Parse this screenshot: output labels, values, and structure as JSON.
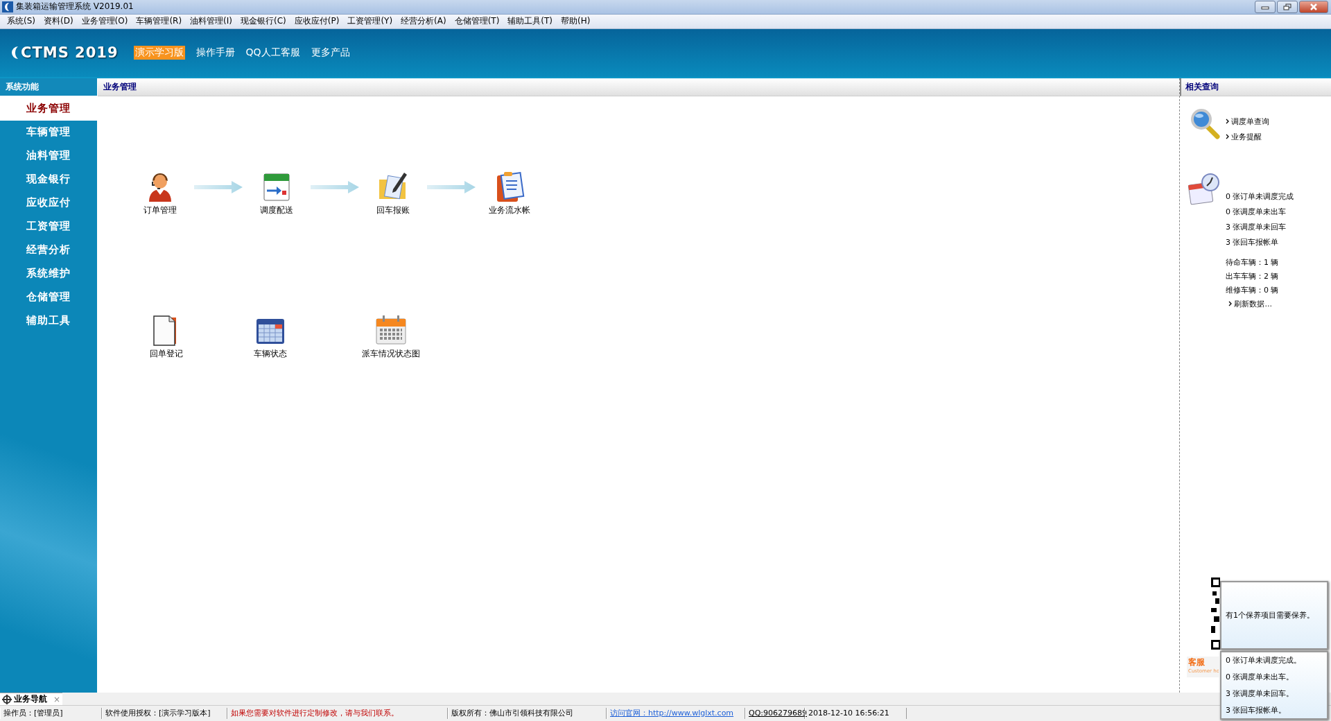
{
  "window": {
    "title": "集装箱运输管理系统 V2019.01"
  },
  "menu": [
    "系统(S)",
    "资料(D)",
    "业务管理(O)",
    "车辆管理(R)",
    "油料管理(I)",
    "现金银行(C)",
    "应收应付(P)",
    "工资管理(Y)",
    "经营分析(A)",
    "仓储管理(T)",
    "辅助工具(T)",
    "帮助(H)"
  ],
  "header": {
    "logo": "CTMS 2019",
    "badge": "演示学习版",
    "links": [
      "操作手册",
      "QQ人工客服",
      "更多产品"
    ]
  },
  "sidebar": {
    "title": "系统功能",
    "items": [
      {
        "label": "业务管理",
        "selected": true
      },
      {
        "label": "车辆管理",
        "selected": false
      },
      {
        "label": "油料管理",
        "selected": false
      },
      {
        "label": "现金银行",
        "selected": false
      },
      {
        "label": "应收应付",
        "selected": false
      },
      {
        "label": "工资管理",
        "selected": false
      },
      {
        "label": "经营分析",
        "selected": false
      },
      {
        "label": "系统维护",
        "selected": false
      },
      {
        "label": "仓储管理",
        "selected": false
      },
      {
        "label": "辅助工具",
        "selected": false
      }
    ]
  },
  "main": {
    "title": "业务管理",
    "flow": [
      {
        "label": "订单管理",
        "kind": "operator"
      },
      {
        "label": "调度配送",
        "kind": "schedule"
      },
      {
        "label": "回车报账",
        "kind": "folder"
      },
      {
        "label": "业务流水帐",
        "kind": "clipboard"
      }
    ],
    "tools": [
      {
        "label": "回单登记",
        "kind": "document"
      },
      {
        "label": "车辆状态",
        "kind": "calendar"
      },
      {
        "label": "派车情况状态图",
        "kind": "planner"
      }
    ]
  },
  "related": {
    "title": "相关查询",
    "links": [
      "调度单查询",
      "业务提醒"
    ],
    "counts": [
      "0 张订单未调度完成",
      "0 张调度单未出车",
      "3 张调度单未回车",
      "3 张回车报帐单"
    ],
    "vehicles": [
      "待命车辆：1 辆",
      "出车车辆：2 辆",
      "维修车辆：0 辆"
    ],
    "refresh": "刷新数据...",
    "service": {
      "label": "客服",
      "sublabel": "Customer ho"
    }
  },
  "bottom_tab": {
    "label": "业务导航",
    "close": "×"
  },
  "status_bar": [
    {
      "text": "操作员：[管理员]",
      "kind": "text"
    },
    {
      "text": "软件使用授权：[演示学习版本]",
      "kind": "text"
    },
    {
      "text": "如果您需要对软件进行定制修改，请与我们联系。",
      "kind": "warning"
    },
    {
      "text": "版权所有：佛山市引领科技有限公司",
      "kind": "text"
    },
    {
      "text": "访问官网：http://www.wlglxt.com",
      "kind": "link"
    },
    {
      "text": "QQ:906279689",
      "kind": "underline"
    },
    {
      "text": "2018-12-10 16:56:21",
      "kind": "text"
    }
  ],
  "popups": [
    {
      "lines": [
        "有1个保养项目需要保养。"
      ]
    },
    {
      "lines": [
        "0 张订单未调度完成。",
        "0 张调度单未出车。",
        "3 张调度单未回车。",
        "3 张回车报帐单。"
      ]
    }
  ]
}
